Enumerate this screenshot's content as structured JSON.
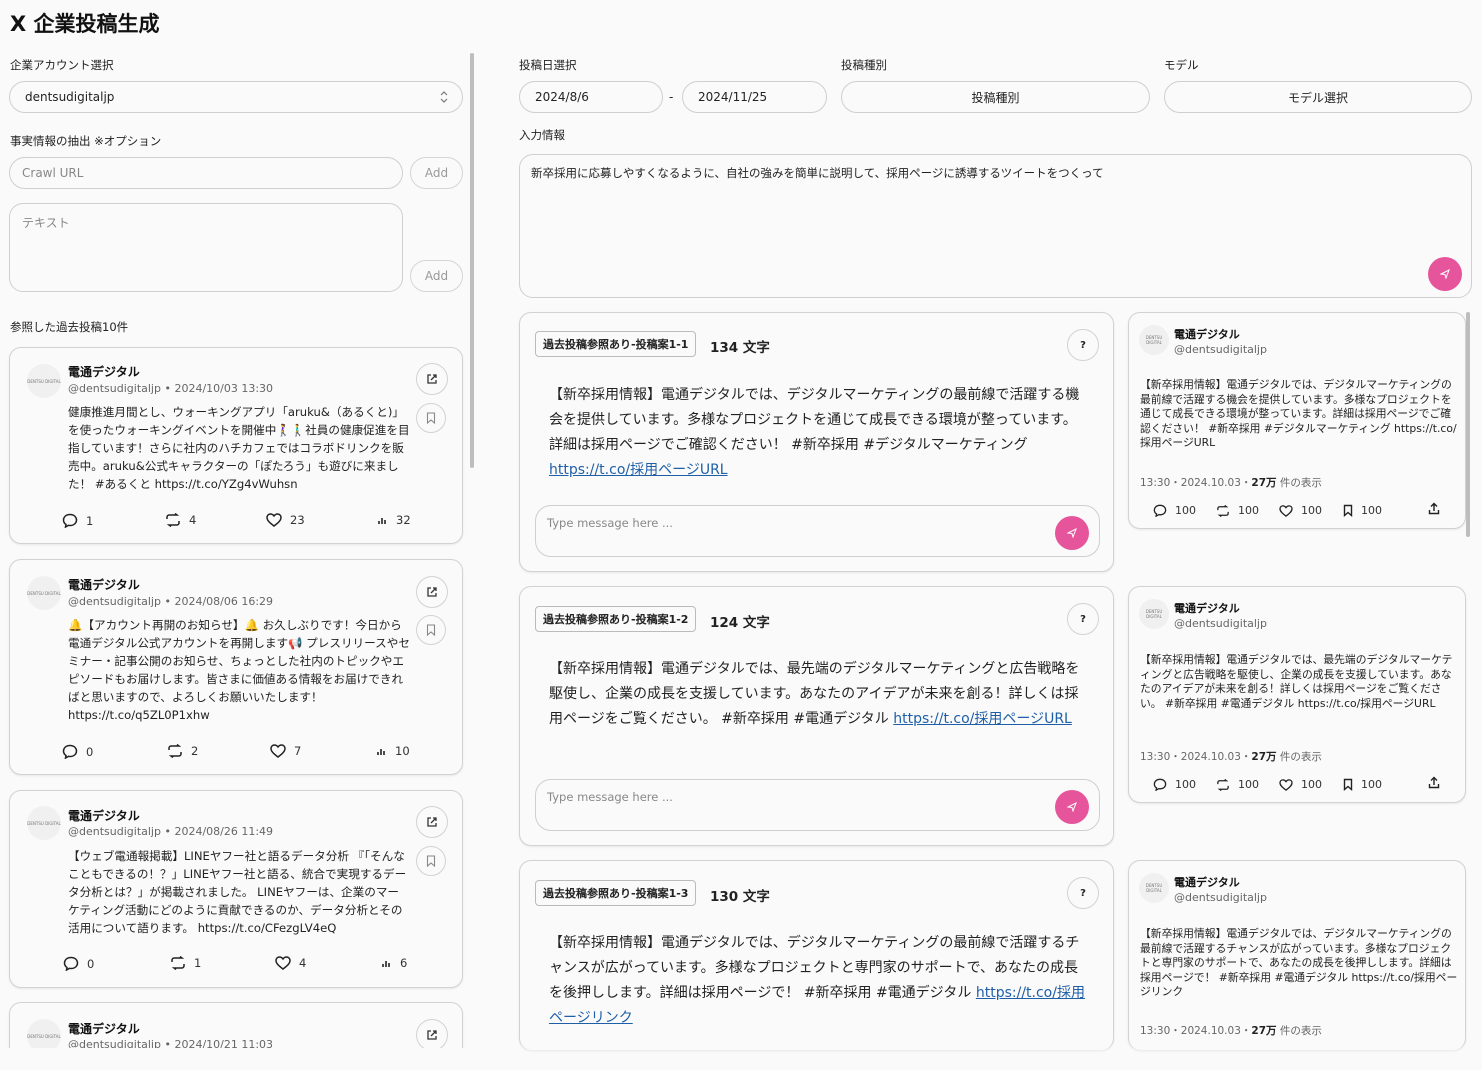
{
  "app": {
    "title": "X 企業投稿生成"
  },
  "left": {
    "account_label": "企業アカウント選択",
    "account_value": "dentsudigitaljp",
    "facts_label": "事実情報の抽出 ※オプション",
    "crawl_placeholder": "Crawl URL",
    "text_placeholder": "テキスト",
    "add_label": "Add",
    "past_posts_label": "参照した過去投稿10件",
    "posts": [
      {
        "name": "電通デジタル",
        "handle": "@dentsudigitaljp",
        "date": "2024/10/03 13:30",
        "body": "健康推進月間とし、ウォーキングアプリ「aruku&（あるくと)」を使ったウォーキングイベントを開催中🚶‍♀️🚶‍♂️社員の健康促進を目指しています！さらに社内のハチカフェではコラボドリンクを販売中。aruku&公式キャラクターの「ぽたろう」も遊びに来ました！ #あるくと https://t.co/YZg4vWuhsn",
        "replies": "1",
        "retweets": "4",
        "likes": "23",
        "views": "32"
      },
      {
        "name": "電通デジタル",
        "handle": "@dentsudigitaljp",
        "date": "2024/08/06 16:29",
        "body": "🔔【アカウント再開のお知らせ】🔔 お久しぶりです！今日から電通デジタル公式アカウントを再開します📢 プレスリリースやセミナー・記事公開のお知らせ、ちょっとした社内のトピックやエピソードもお届けします。皆さまに価値ある情報をお届けできればと思いますので、よろしくお願いいたします！ https://t.co/q5ZL0P1xhw",
        "replies": "0",
        "retweets": "2",
        "likes": "7",
        "views": "10"
      },
      {
        "name": "電通デジタル",
        "handle": "@dentsudigitaljp",
        "date": "2024/08/26 11:49",
        "body": "【ウェブ電通報掲載】LINEヤフー社と語るデータ分析 『「そんなこともできるの！？」LINEヤフー社と語る、統合で実現するデータ分析とは？」が掲載されました。 LINEヤフーは、企業のマーケティング活動にどのように貢献できるのか、データ分析とその活用について語ります。 https://t.co/CFezgLV4eQ",
        "replies": "0",
        "retweets": "1",
        "likes": "4",
        "views": "6"
      },
      {
        "name": "電通デジタル",
        "handle": "@dentsudigitaljp",
        "date": "2024/10/21 11:03"
      }
    ]
  },
  "right": {
    "date_label": "投稿日選択",
    "date_from": "2024/8/6",
    "date_sep": "-",
    "date_to": "2024/11/25",
    "type_label": "投稿種別",
    "type_button": "投稿種別",
    "model_label": "モデル",
    "model_button": "モデル選択",
    "input_label": "入力情報",
    "input_value": "新卒採用に応募しやすくなるように、自社の強みを簡単に説明して、採用ページに誘導するツイートをつくって",
    "msg_placeholder": "Type message here ...",
    "help": "?",
    "drafts": [
      {
        "tag": "過去投稿参照あり-投稿案1-1",
        "count": "134 文字",
        "text": "【新卒採用情報】電通デジタルでは、デジタルマーケティングの最前線で活躍する機会を提供しています。多様なプロジェクトを通じて成長できる環境が整っています。詳細は採用ページでご確認ください！ #新卒採用 #デジタルマーケティング ",
        "link": "https://t.co/採用ページURL",
        "preview": "【新卒採用情報】電通デジタルでは、デジタルマーケティングの最前線で活躍する機会を提供しています。多様なプロジェクトを通じて成長できる環境が整っています。詳細は採用ページでご確認ください！ #新卒採用 #デジタルマーケティング https://t.co/採用ページURL"
      },
      {
        "tag": "過去投稿参照あり-投稿案1-2",
        "count": "124 文字",
        "text": "【新卒採用情報】電通デジタルでは、最先端のデジタルマーケティングと広告戦略を駆使し、企業の成長を支援しています。あなたのアイデアが未来を創る！詳しくは採用ページをご覧ください。 #新卒採用 #電通デジタル ",
        "link": "https://t.co/採用ページURL",
        "preview": "【新卒採用情報】電通デジタルでは、最先端のデジタルマーケティングと広告戦略を駆使し、企業の成長を支援しています。あなたのアイデアが未来を創る！詳しくは採用ページをご覧ください。 #新卒採用 #電通デジタル https://t.co/採用ページURL"
      },
      {
        "tag": "過去投稿参照あり-投稿案1-3",
        "count": "130 文字",
        "text": "【新卒採用情報】電通デジタルでは、デジタルマーケティングの最前線で活躍するチャンスが広がっています。多様なプロジェクトと専門家のサポートで、あなたの成長を後押しします。詳細は採用ページで！ #新卒採用 #電通デジタル ",
        "link": "https://t.co/採用ページリンク",
        "preview": "【新卒採用情報】電通デジタルでは、デジタルマーケティングの最前線で活躍するチャンスが広がっています。多様なプロジェクトと専門家のサポートで、あなたの成長を後押しします。詳細は採用ページで！ #新卒採用 #電通デジタル https://t.co/採用ページリンク"
      }
    ],
    "preview_common": {
      "name": "電通デジタル",
      "handle": "@dentsudigitaljp",
      "time": "13:30・2024.10.03・",
      "views_num": "27万",
      "views_suffix": " 件の表示",
      "stat": "100"
    }
  },
  "avatar_text": "DENTSU DIGITAL",
  "colors": {
    "accent": "#e6549b",
    "link": "#1f5fa8"
  }
}
